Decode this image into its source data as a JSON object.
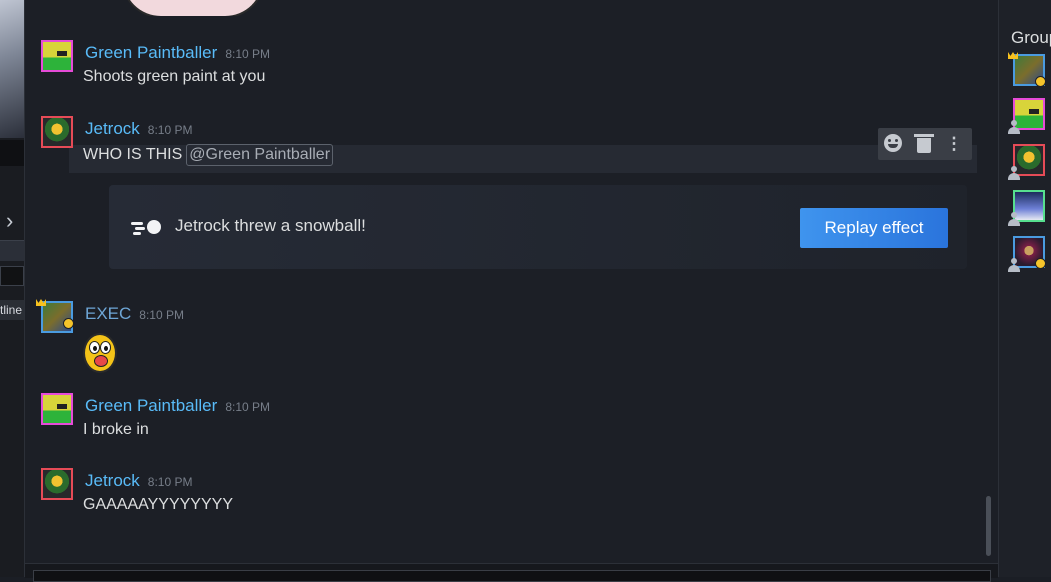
{
  "left_strip": {
    "chevron": "›",
    "outline_label": "tline"
  },
  "messages": [
    {
      "author": "Green Paintballer",
      "time": "8:10 PM",
      "text": "Shoots green paint at you"
    },
    {
      "author": "Jetrock",
      "time": "8:10 PM",
      "text": "WHO IS THIS",
      "mention": "@Green Paintballer"
    },
    {
      "author": "EXEC",
      "time": "8:10 PM",
      "text": ""
    },
    {
      "author": "Green Paintballer",
      "time": "8:10 PM",
      "text": "I broke in"
    },
    {
      "author": "Jetrock",
      "time": "8:10 PM",
      "text": "GAAAAAYYYYYYYY"
    }
  ],
  "message_actions": {
    "more_glyph": "⋮"
  },
  "effect": {
    "text": "Jetrock threw a snowball!",
    "button_label": "Replay effect"
  },
  "right_panel": {
    "title": "Group"
  },
  "colors": {
    "accent_blue": "#59bbf8",
    "button_blue": "#2a74dc",
    "background": "#1c1f26"
  }
}
